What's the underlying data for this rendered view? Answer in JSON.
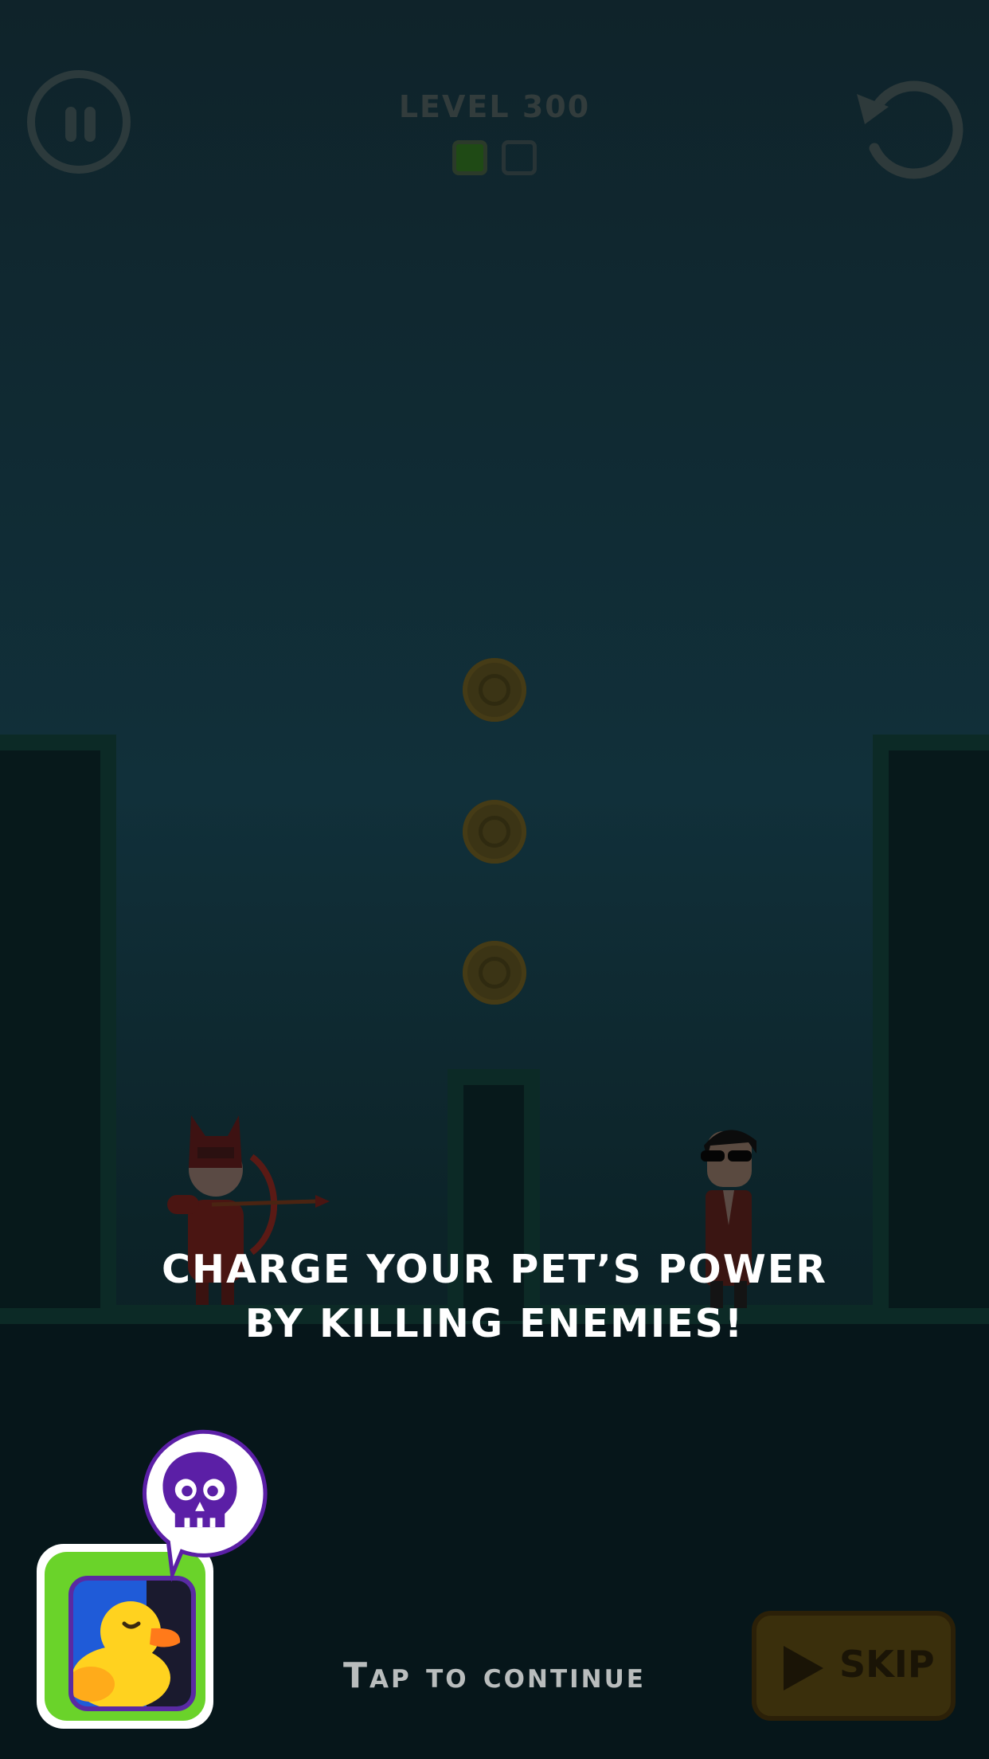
{
  "hud": {
    "level_title": "LEVEL 300",
    "stages_total": 2,
    "stages_completed": 1,
    "pause_icon": "pause-icon",
    "restart_icon": "restart-icon"
  },
  "scene": {
    "coins": 3,
    "player": "archer-hero",
    "enemy": "suited-agent"
  },
  "tutorial": {
    "line1": "CHARGE YOUR PET’S POWER",
    "line2": "BY KILLING ENEMIES!",
    "tap": "Tap to continue"
  },
  "skip_button": {
    "label": "SKIP",
    "icon": "play-triangle-icon"
  },
  "pet": {
    "icon": "rubber-duck-icon",
    "bubble_icon": "skull-icon",
    "accent": "#6ad32a",
    "bubble_color": "#5b1fa6"
  }
}
